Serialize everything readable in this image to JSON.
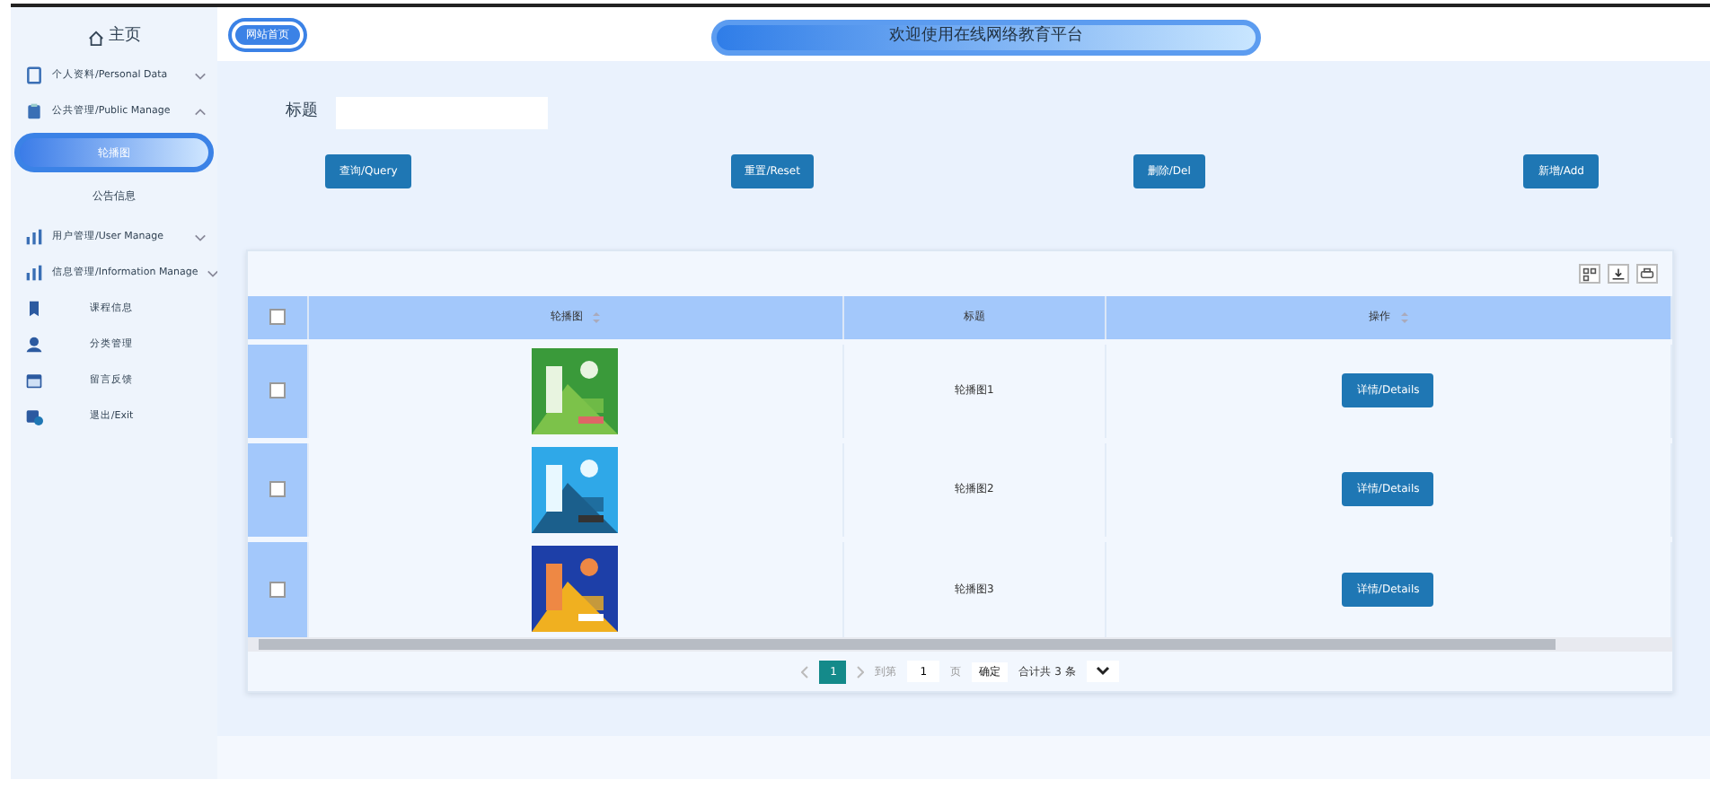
{
  "sidebar": {
    "home": "主页",
    "menu": [
      {
        "kind": "group",
        "label": "个人资料/Personal Data",
        "expanded": false
      },
      {
        "kind": "group",
        "label": "公共管理/Public Manage",
        "expanded": true,
        "children": [
          {
            "label": "轮播图",
            "selected": true
          },
          {
            "label": "公告信息",
            "selected": false
          }
        ]
      },
      {
        "kind": "group",
        "label": "用户管理/User Manage",
        "expanded": false
      },
      {
        "kind": "group",
        "label": "信息管理/Information Manage",
        "expanded": false
      },
      {
        "kind": "leaf",
        "label": "课程信息"
      },
      {
        "kind": "leaf",
        "label": "分类管理"
      },
      {
        "kind": "leaf",
        "label": "留言反馈"
      },
      {
        "kind": "leaf",
        "label": "退出/Exit"
      }
    ]
  },
  "header": {
    "tab": "网站首页",
    "title": "欢迎使用在线网络教育平台"
  },
  "search": {
    "label": "标题"
  },
  "buttons": [
    "查询/Query",
    "重置/Reset",
    "删除/Del",
    "新增/Add"
  ],
  "table": {
    "select_all_checked": false,
    "columns": [
      {
        "label": "轮播图",
        "sortable": true
      },
      {
        "label": "标题",
        "sortable": false
      },
      {
        "label": "操作",
        "sortable": true
      }
    ],
    "rows": [
      {
        "checked": false,
        "title": "轮播图1",
        "action": "详情/Details"
      },
      {
        "checked": false,
        "title": "轮播图2",
        "action": "详情/Details"
      },
      {
        "checked": false,
        "title": "轮播图3",
        "action": "详情/Details"
      }
    ]
  },
  "pagination": {
    "current": "1",
    "goto_label": "到第",
    "goto_value": "1",
    "page_unit": "页",
    "confirm": "确定",
    "total": "合计共 3 条"
  }
}
